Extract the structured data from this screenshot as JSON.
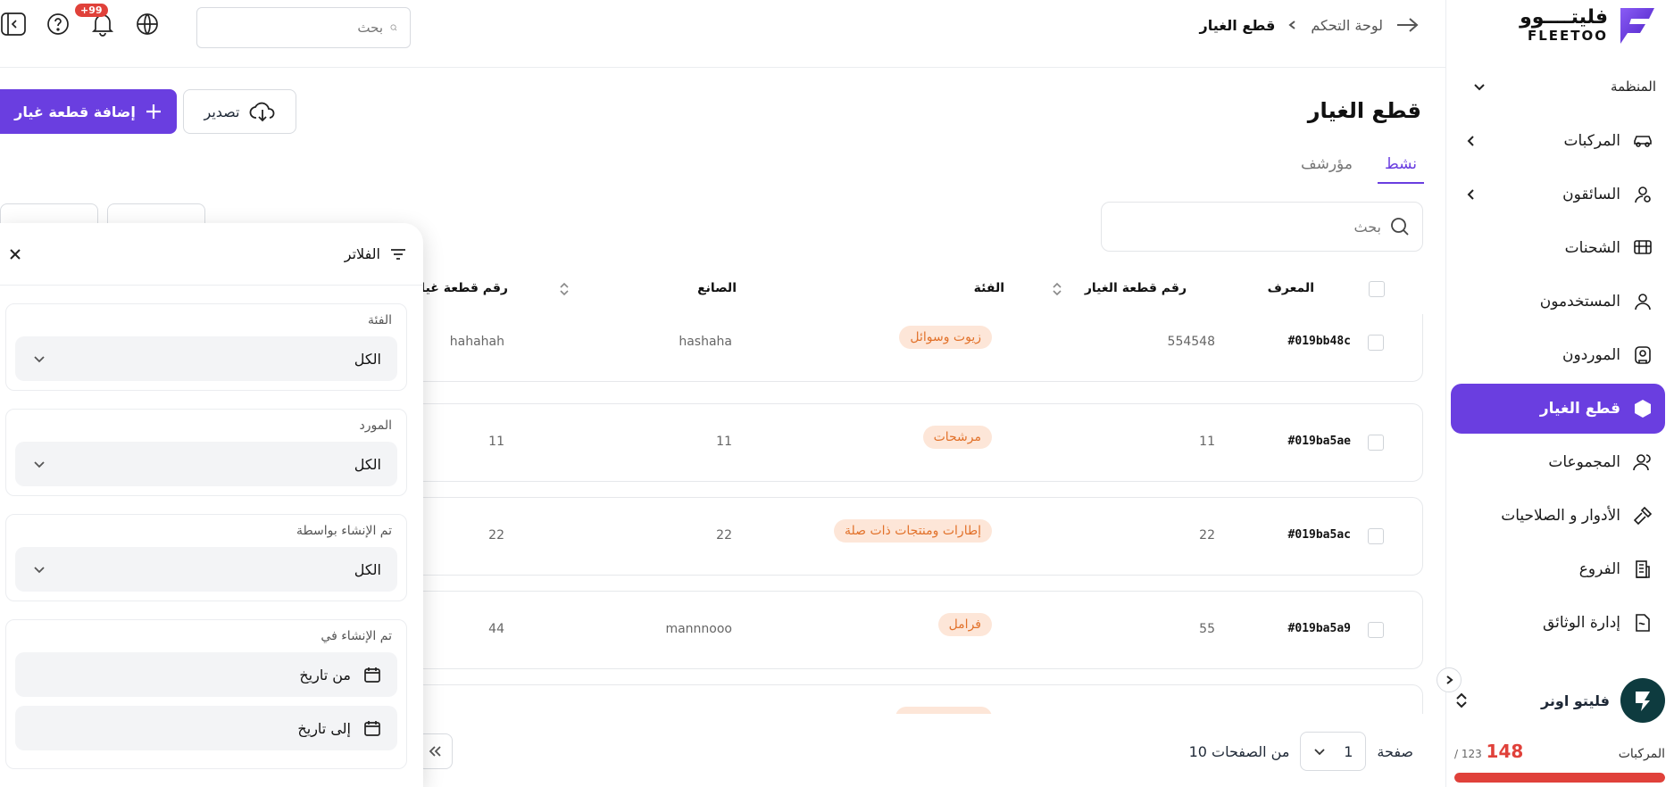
{
  "brand": {
    "name_ar": "فليتــــوو",
    "name_en": "FLEETOO"
  },
  "sidebar": {
    "org_label": "المنظمة",
    "items": [
      {
        "label": "المركبات",
        "icon": "car-icon",
        "chevron": true
      },
      {
        "label": "السائقون",
        "icon": "driver-icon",
        "chevron": true
      },
      {
        "label": "الشحنات",
        "icon": "truck-icon",
        "chevron": false
      },
      {
        "label": "المستخدمون",
        "icon": "user-icon",
        "chevron": false
      },
      {
        "label": "الموردون",
        "icon": "supplier-icon",
        "chevron": false
      },
      {
        "label": "قطع الغيار",
        "icon": "box-icon",
        "chevron": false,
        "active": true
      },
      {
        "label": "المجموعات",
        "icon": "group-icon",
        "chevron": false
      },
      {
        "label": "الأدوار و الصلاحيات",
        "icon": "hammer-icon",
        "chevron": false
      },
      {
        "label": "الفروع",
        "icon": "building-icon",
        "chevron": false
      },
      {
        "label": "إدارة الوثائق",
        "icon": "document-icon",
        "chevron": false
      }
    ],
    "account": {
      "name": "فليتو اونر"
    },
    "vehicles": {
      "label": "المركبات",
      "used": "148",
      "total": "/ 123",
      "progress_percent": 100
    }
  },
  "header": {
    "breadcrumb": {
      "parent": "لوحة التحكم",
      "current": "قطع الغيار"
    },
    "search_placeholder": "بحث",
    "notifications_badge": "+99"
  },
  "page": {
    "title": "قطع الغيار",
    "tabs": [
      {
        "label": "نشط",
        "active": true
      },
      {
        "label": "مؤرشف",
        "active": false
      }
    ],
    "add_button": "إضافة قطعة غيار",
    "export_button": "تصدير",
    "search_placeholder": "بحث"
  },
  "table": {
    "columns": {
      "id": "المعرف",
      "part_number": "رقم قطعة الغيار",
      "category": "الفئة",
      "manufacturer": "الصانع",
      "supplier_part_number": "رقم قطعة غيار"
    },
    "rows": [
      {
        "id": "#019bb48c",
        "part_number": "554548",
        "category": "زيوت وسوائل",
        "manufacturer": "hashaha",
        "supplier_part_number": "hahahah"
      },
      {
        "id": "#019ba5ae",
        "part_number": "11",
        "category": "مرشحات",
        "manufacturer": "11",
        "supplier_part_number": "11"
      },
      {
        "id": "#019ba5ac",
        "part_number": "22",
        "category": "إطارات ومنتجات ذات صلة",
        "manufacturer": "22",
        "supplier_part_number": "22"
      },
      {
        "id": "#019ba5a9",
        "part_number": "55",
        "category": "فرامل",
        "manufacturer": "mannnooo",
        "supplier_part_number": "44"
      }
    ]
  },
  "pagination": {
    "page_label": "صفحة",
    "current_page": "1",
    "of_pages": "من الصفحات 10"
  },
  "filters": {
    "title": "الفلاتر",
    "groups": [
      {
        "label": "الفئة",
        "value": "الكل"
      },
      {
        "label": "المورد",
        "value": "الكل"
      },
      {
        "label": "تم الإنشاء بواسطة",
        "value": "الكل"
      }
    ],
    "date_group": {
      "label": "تم الإنشاء في",
      "from": "من تاريخ",
      "to": "إلى تاريخ"
    }
  },
  "colors": {
    "accent": "#6a3ee0",
    "danger": "#e0413a",
    "badge_bg": "#fde6d8",
    "badge_text": "#e2722b"
  }
}
